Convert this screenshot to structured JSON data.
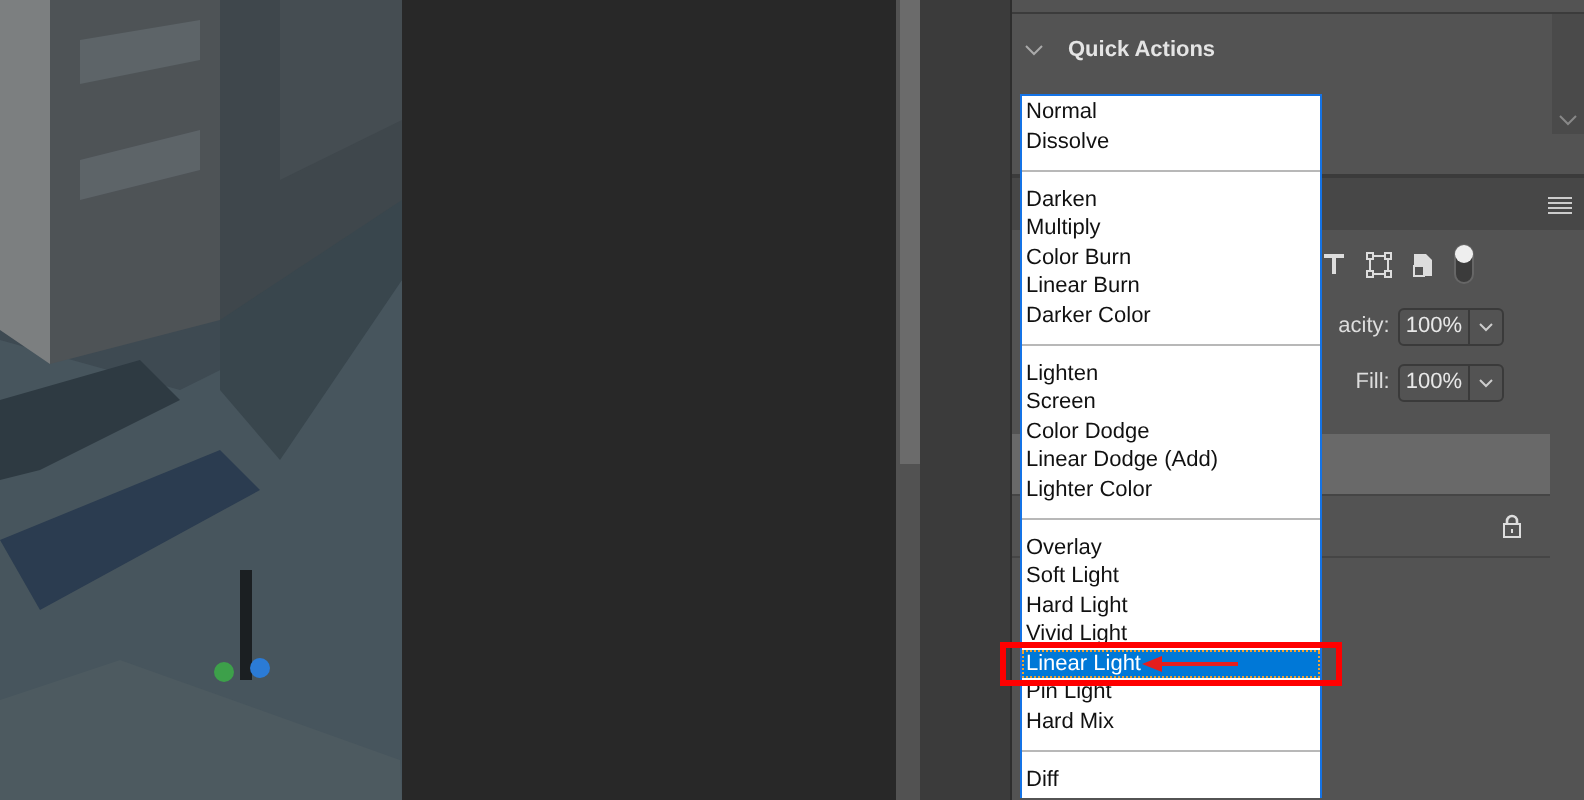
{
  "quick_actions": {
    "title": "Quick Actions",
    "expanded": true
  },
  "layers_panel": {
    "opacity_label": "acity:",
    "opacity": "100%",
    "fill_label": "Fill:",
    "fill": "100%",
    "layers": [
      {
        "selected": true,
        "locked": false
      },
      {
        "selected": false,
        "locked": true
      }
    ]
  },
  "blend_menu": {
    "groups": [
      {
        "items": [
          {
            "label": "Normal",
            "selected": false
          },
          {
            "label": "Dissolve",
            "selected": false
          }
        ]
      },
      {
        "items": [
          {
            "label": "Darken",
            "selected": false
          },
          {
            "label": "Multiply",
            "selected": false
          },
          {
            "label": "Color Burn",
            "selected": false
          },
          {
            "label": "Linear Burn",
            "selected": false
          },
          {
            "label": "Darker Color",
            "selected": false
          }
        ]
      },
      {
        "items": [
          {
            "label": "Lighten",
            "selected": false
          },
          {
            "label": "Screen",
            "selected": false
          },
          {
            "label": "Color Dodge",
            "selected": false
          },
          {
            "label": "Linear Dodge (Add)",
            "selected": false
          },
          {
            "label": "Lighter Color",
            "selected": false
          }
        ]
      },
      {
        "items": [
          {
            "label": "Overlay",
            "selected": false
          },
          {
            "label": "Soft Light",
            "selected": false
          },
          {
            "label": "Hard Light",
            "selected": false
          },
          {
            "label": "Vivid Light",
            "selected": false
          },
          {
            "label": "Linear Light",
            "selected": true
          },
          {
            "label": "Pin Light",
            "selected": false
          },
          {
            "label": "Hard Mix",
            "selected": false
          }
        ]
      },
      {
        "items": [
          {
            "label": "Diff",
            "selected": false
          }
        ]
      }
    ]
  }
}
